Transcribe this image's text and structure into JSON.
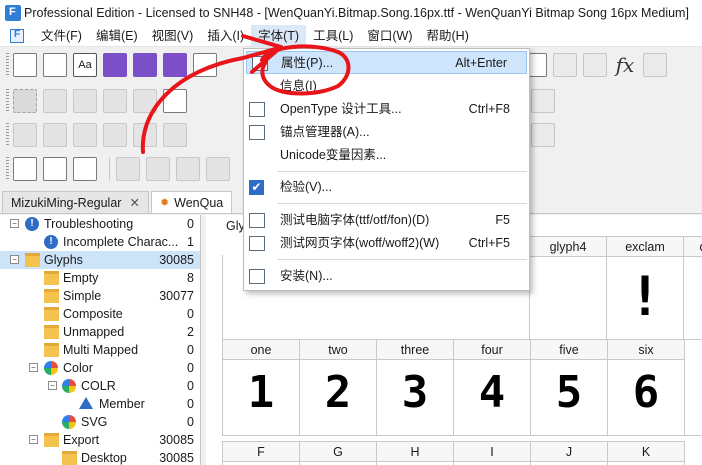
{
  "window": {
    "title": "Professional Edition - Licensed to SNH48 - [WenQuanYi.Bitmap.Song.16px.ttf - WenQuanYi Bitmap Song 16px Medium]"
  },
  "menubar": {
    "items": [
      "文件(F)",
      "编辑(E)",
      "视图(V)",
      "插入(I)",
      "字体(T)",
      "工具(L)",
      "窗口(W)",
      "帮助(H)"
    ],
    "active_index": 4
  },
  "toolbar": {
    "fx_label": "fx"
  },
  "tabs": [
    {
      "label": "MizukiMing-Regular",
      "close": "✕"
    },
    {
      "label": "WenQua"
    }
  ],
  "sidebar": {
    "items": [
      {
        "label": "Troubleshooting",
        "count": "0",
        "icon": "warning-icon",
        "expander": "−"
      },
      {
        "label": "Incomplete Charac...",
        "count": "1",
        "icon": "warning-icon",
        "expander": ""
      },
      {
        "label": "Glyphs",
        "count": "30085",
        "icon": "folder-icon",
        "expander": "−"
      },
      {
        "label": "Empty",
        "count": "8",
        "icon": "folder-icon",
        "expander": ""
      },
      {
        "label": "Simple",
        "count": "30077",
        "icon": "folder-icon",
        "expander": ""
      },
      {
        "label": "Composite",
        "count": "0",
        "icon": "folder-icon",
        "expander": ""
      },
      {
        "label": "Unmapped",
        "count": "2",
        "icon": "folder-icon",
        "expander": ""
      },
      {
        "label": "Multi Mapped",
        "count": "0",
        "icon": "folder-icon",
        "expander": ""
      },
      {
        "label": "Color",
        "count": "0",
        "icon": "color-icon",
        "expander": "−"
      },
      {
        "label": "COLR",
        "count": "0",
        "icon": "color-icon",
        "expander": "−"
      },
      {
        "label": "Member",
        "count": "0",
        "icon": "triangle-icon",
        "expander": ""
      },
      {
        "label": "SVG",
        "count": "0",
        "icon": "color-icon",
        "expander": ""
      },
      {
        "label": "Export",
        "count": "30085",
        "icon": "folder-icon",
        "expander": "−"
      },
      {
        "label": "Desktop",
        "count": "30085",
        "icon": "folder-icon",
        "expander": ""
      }
    ]
  },
  "glyph_panel": {
    "label": "Gly",
    "row0_headers": [
      "glyph4",
      "exclam",
      "q"
    ],
    "row0_glyphs": [
      "",
      "!",
      ""
    ],
    "row1_headers": [
      "one",
      "two",
      "three",
      "four",
      "five",
      "six"
    ],
    "row1_glyphs": [
      "1",
      "2",
      "3",
      "4",
      "5",
      "6"
    ],
    "row2_headers": [
      "F",
      "G",
      "H",
      "I",
      "J",
      "K"
    ]
  },
  "font_menu": {
    "items": [
      {
        "label": "属性(P)...",
        "shortcut": "Alt+Enter",
        "icon": "properties-icon"
      },
      {
        "label": "信息(I)",
        "shortcut": "",
        "icon": "info-icon"
      },
      {
        "label": "OpenType 设计工具...",
        "shortcut": "Ctrl+F8",
        "icon": "opentype-icon"
      },
      {
        "label": "锚点管理器(A)...",
        "shortcut": "",
        "icon": "anchor-icon"
      },
      {
        "label": "Unicode变量因素...",
        "shortcut": "",
        "icon": ""
      },
      {
        "label": "检验(V)...",
        "shortcut": "",
        "icon": "check-icon"
      },
      {
        "label": "测试电脑字体(ttf/otf/fon)(D)",
        "shortcut": "F5",
        "icon": "test-desktop-icon"
      },
      {
        "label": "测试网页字体(woff/woff2)(W)",
        "shortcut": "Ctrl+F5",
        "icon": "test-web-icon"
      },
      {
        "label": "安装(N)...",
        "shortcut": "",
        "icon": "install-icon"
      }
    ]
  },
  "annotation_color": "#e8151b"
}
